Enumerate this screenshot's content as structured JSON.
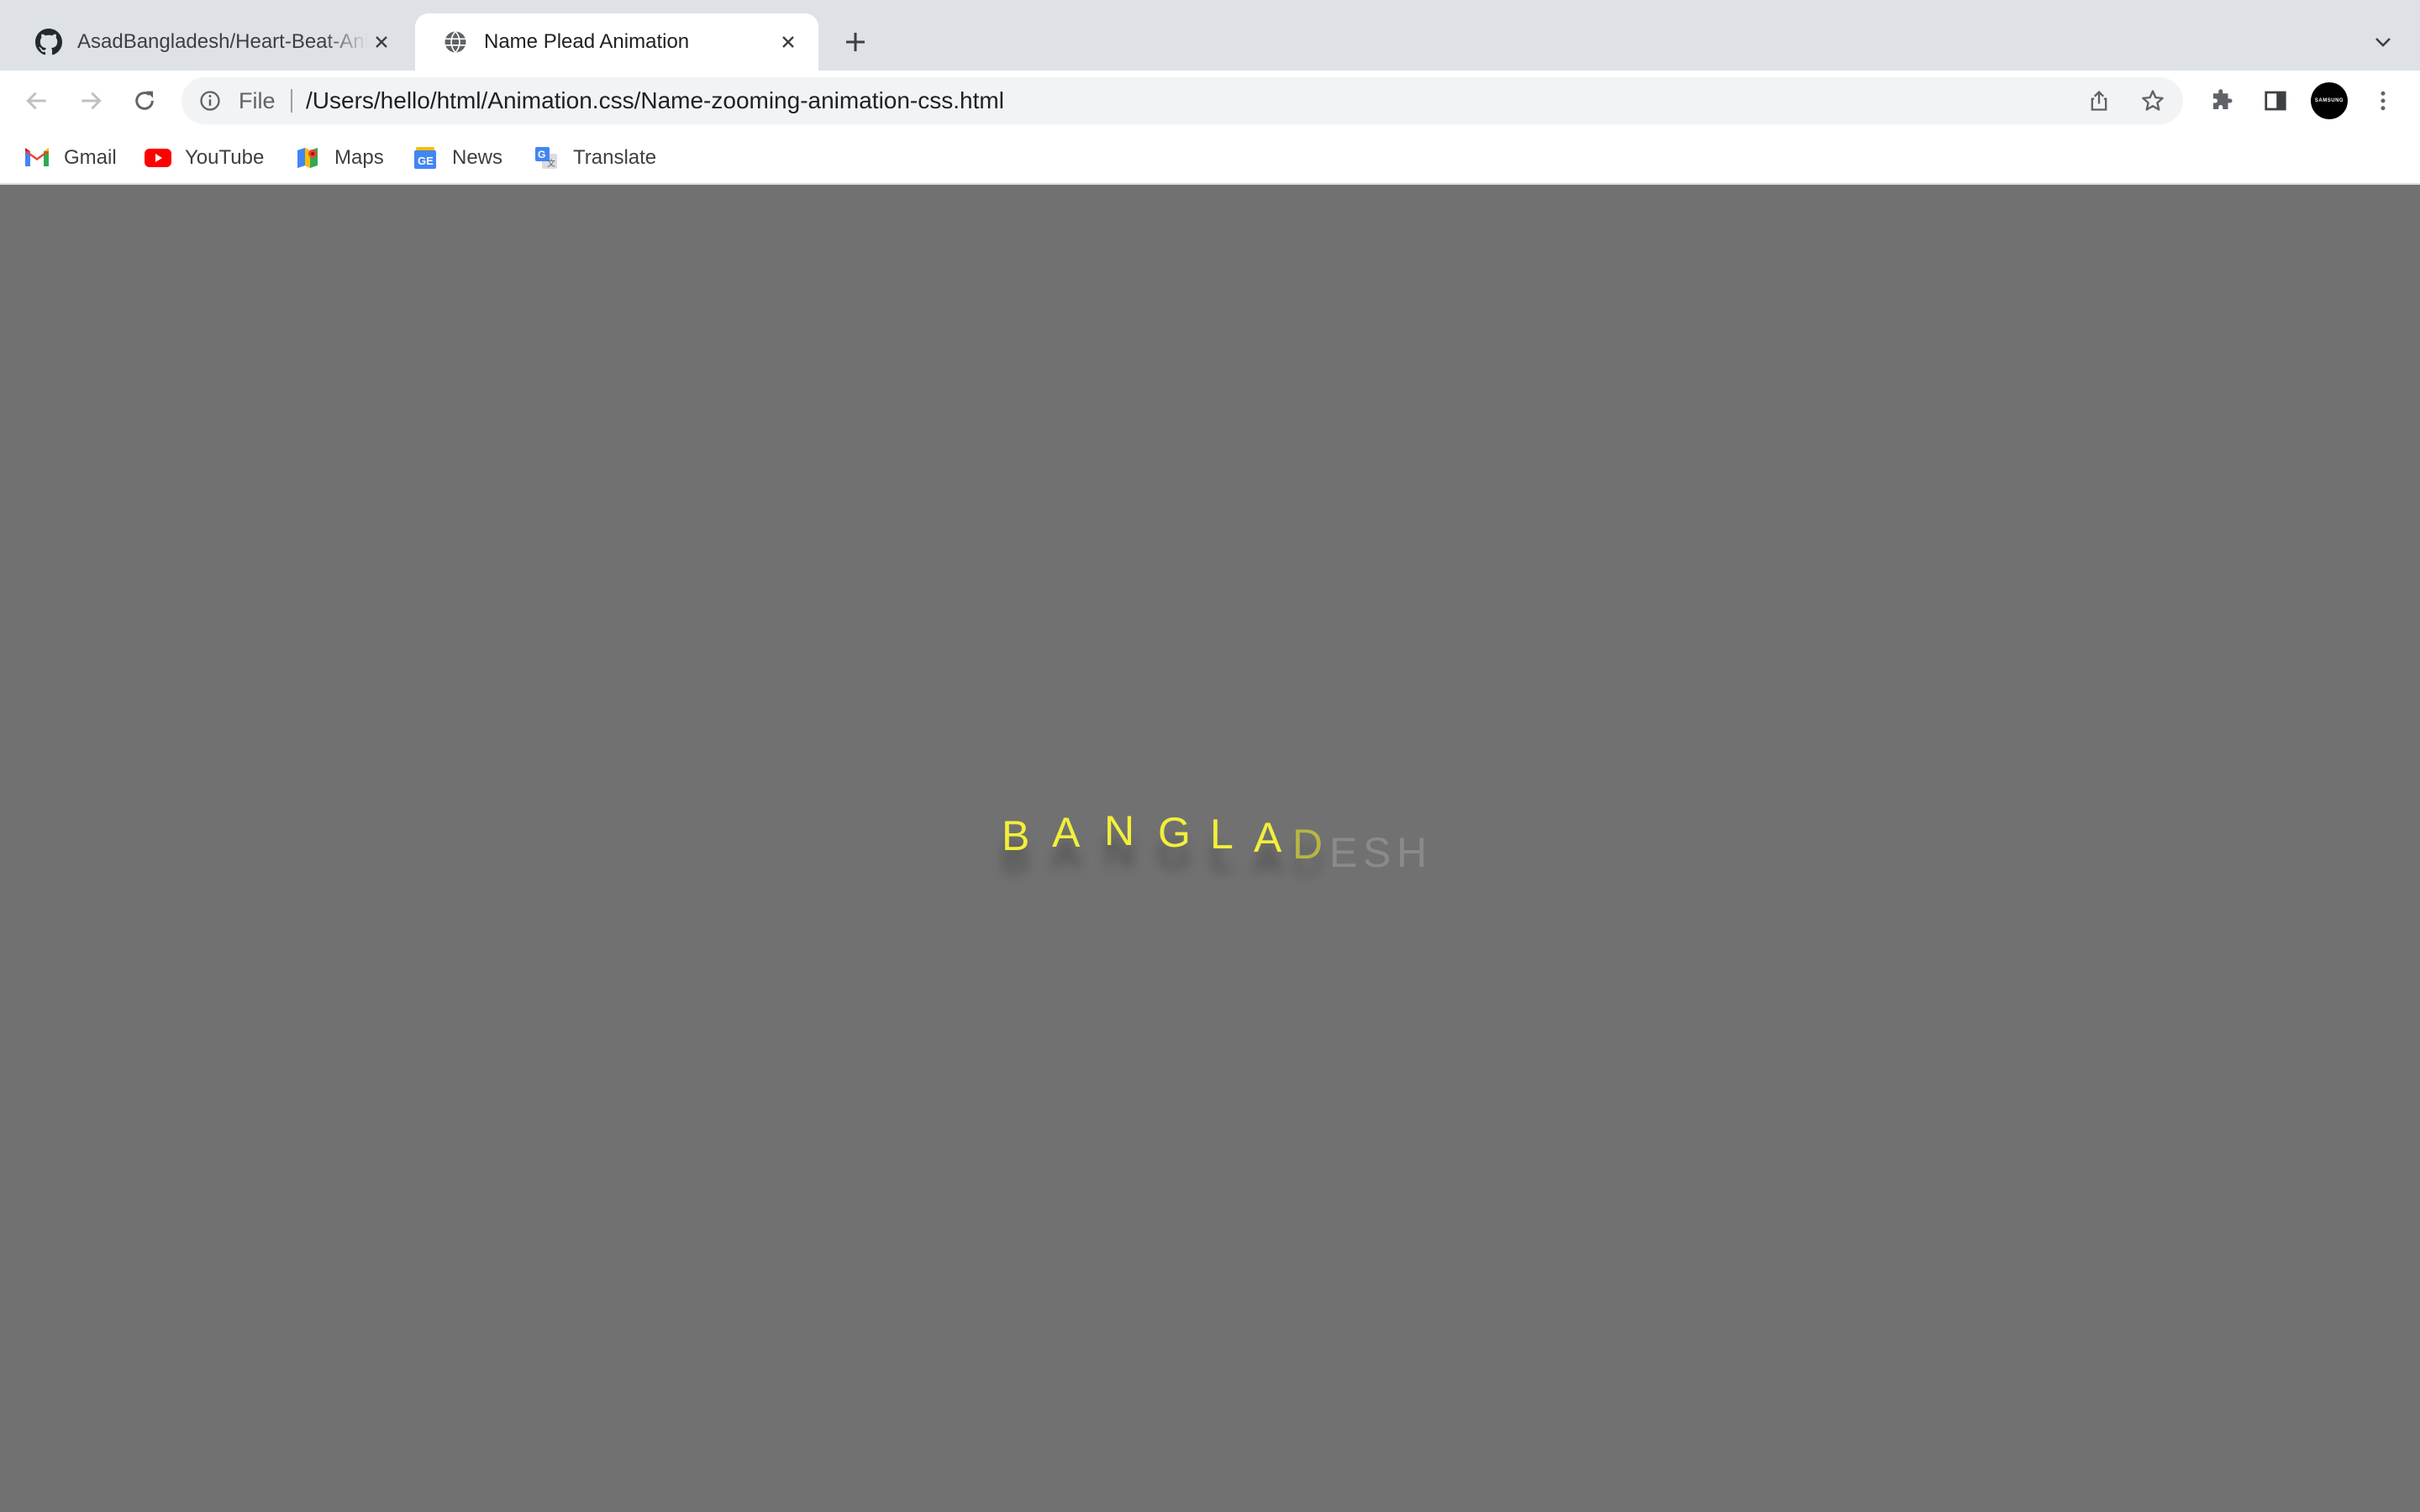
{
  "browser": {
    "tabs": [
      {
        "title": "AsadBangladesh/Heart-Beat-Animation",
        "favicon": "github-icon",
        "active": false
      },
      {
        "title": "Name Plead Animation",
        "favicon": "globe-icon",
        "active": true
      }
    ],
    "omnibox": {
      "scheme_label": "File",
      "url": "/Users/hello/html/Animation.css/Name-zooming-animation-css.html"
    },
    "profile_label": "SAMSUNG",
    "bookmarks": [
      {
        "label": "Gmail",
        "icon": "gmail-icon"
      },
      {
        "label": "YouTube",
        "icon": "youtube-icon"
      },
      {
        "label": "Maps",
        "icon": "maps-icon"
      },
      {
        "label": "News",
        "icon": "news-icon"
      },
      {
        "label": "Translate",
        "icon": "translate-icon"
      }
    ]
  },
  "page": {
    "background": "#717171",
    "accent": "#f2ef3a",
    "letters": [
      "B",
      "A",
      "N",
      "G",
      "L",
      "A",
      "D",
      "E",
      "S",
      "H"
    ]
  }
}
